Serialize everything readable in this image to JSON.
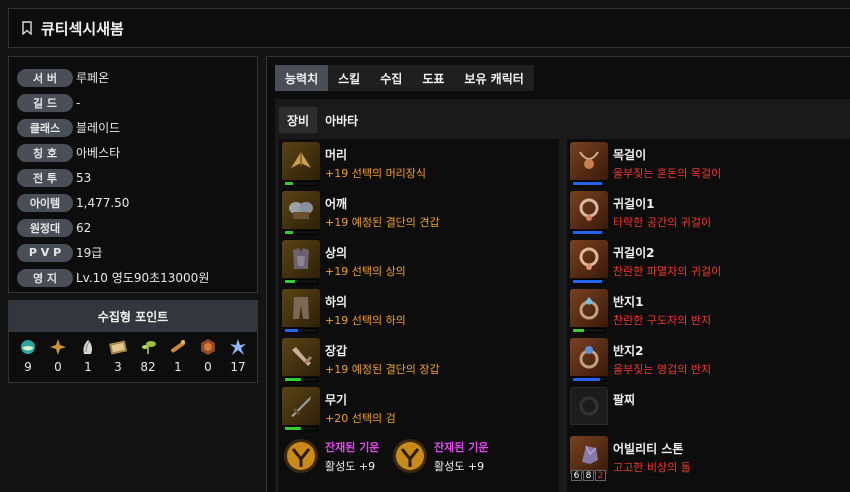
{
  "character": {
    "name": "큐티섹시새봄"
  },
  "info": [
    {
      "label": "서 버",
      "value": "루페온"
    },
    {
      "label": "길 드",
      "value": "-"
    },
    {
      "label": "클래스",
      "value": "블레이드"
    },
    {
      "label": "칭 호",
      "value": "아베스타"
    },
    {
      "label": "전 투",
      "value": "53"
    },
    {
      "label": "아이템",
      "value": "1,477.50"
    },
    {
      "label": "원정대",
      "value": "62"
    },
    {
      "label": "P V P",
      "value": "19급"
    },
    {
      "label": "영 지",
      "value": "Lv.10 영도90초13000원"
    }
  ],
  "collect": {
    "title": "수집형 포인트",
    "items": [
      {
        "icon": "island-soul-icon",
        "count": "9"
      },
      {
        "icon": "giant-heart-icon",
        "count": "0"
      },
      {
        "icon": "mokoko-seed-icon",
        "count": "1"
      },
      {
        "icon": "art-painting-icon",
        "count": "3"
      },
      {
        "icon": "mokoko-sprout-icon",
        "count": "82"
      },
      {
        "icon": "voyage-adventure-icon",
        "count": "1"
      },
      {
        "icon": "ignea-token-icon",
        "count": "0"
      },
      {
        "icon": "world-tree-leaf-icon",
        "count": "17"
      }
    ]
  },
  "tabs": [
    "능력치",
    "스킬",
    "수집",
    "도표",
    "보유 캐릭터"
  ],
  "subtabs": [
    "장비",
    "아바타"
  ],
  "equipment_left": [
    {
      "name": "머리",
      "sub": "+19 선택의 머리장식",
      "color": "#f0a030",
      "quality": 0.25,
      "qcolor": "#33cc33",
      "icon": "helmet-icon"
    },
    {
      "name": "어깨",
      "sub": "+19 예정된 결단의 견갑",
      "color": "#f0a030",
      "quality": 0.25,
      "qcolor": "#33cc33",
      "icon": "shoulder-icon"
    },
    {
      "name": "상의",
      "sub": "+19 선택의 상의",
      "color": "#f0a030",
      "quality": 0.3,
      "qcolor": "#33cc33",
      "icon": "chest-armor-icon"
    },
    {
      "name": "하의",
      "sub": "+19 선택의 하의",
      "color": "#f0a030",
      "quality": 0.4,
      "qcolor": "#2266ee",
      "icon": "pants-icon"
    },
    {
      "name": "장갑",
      "sub": "+19 예정된 결단의 장갑",
      "color": "#f0a030",
      "quality": 0.5,
      "qcolor": "#33cc33",
      "icon": "gloves-icon"
    },
    {
      "name": "무기",
      "sub": "+20 선택의 검",
      "color": "#f0a030",
      "quality": 0.5,
      "qcolor": "#33cc33",
      "icon": "sword-icon"
    }
  ],
  "elixirs": [
    {
      "name": "잔재된 기운",
      "sub": "활성도 +9"
    },
    {
      "name": "잔재된 기운",
      "sub": "활성도 +9"
    }
  ],
  "equipment_right": [
    {
      "name": "목걸이",
      "sub": "울부짖는 혼돈의 목걸이",
      "color": "#f03a2e",
      "quality": 0.9,
      "qcolor": "#2266ee",
      "icon": "necklace-icon"
    },
    {
      "name": "귀걸이1",
      "sub": "타락한 공간의 귀걸이",
      "color": "#f03a2e",
      "quality": 0.9,
      "qcolor": "#2266ee",
      "icon": "earring-icon"
    },
    {
      "name": "귀걸이2",
      "sub": "찬란한 파멸자의 귀걸이",
      "color": "#f03a2e",
      "quality": 0.9,
      "qcolor": "#2266ee",
      "icon": "earring-icon"
    },
    {
      "name": "반지1",
      "sub": "찬란한 구도자의 반지",
      "color": "#f03a2e",
      "quality": 0.35,
      "qcolor": "#33cc33",
      "icon": "ring-icon"
    },
    {
      "name": "반지2",
      "sub": "울부짖는 영겁의 반지",
      "color": "#f03a2e",
      "quality": 0.85,
      "qcolor": "#2266ee",
      "icon": "ring-icon"
    },
    {
      "name": "팔찌",
      "sub": "",
      "color": "#f03a2e",
      "quality": 0,
      "qcolor": "#2266ee",
      "icon": "bracelet-icon"
    },
    {
      "name": "어빌리티 스톤",
      "sub": "고고한 비상의 돌",
      "color": "#f03a2e",
      "quality": 0,
      "qcolor": "#2266ee",
      "icon": "ability-stone-icon",
      "gems": [
        "6",
        "8",
        "2"
      ]
    }
  ]
}
